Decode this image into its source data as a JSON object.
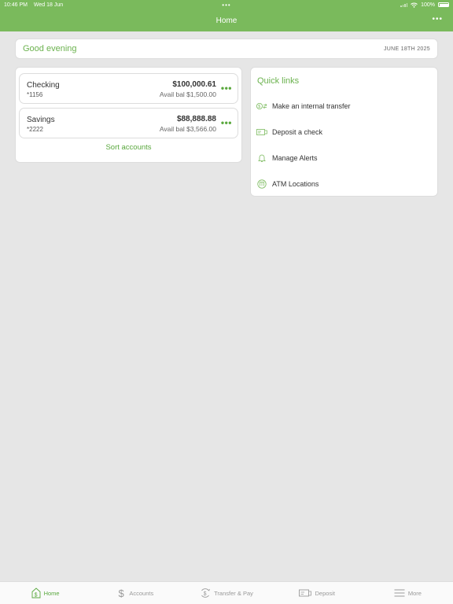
{
  "status_bar": {
    "time": "10:46 PM",
    "date": "Wed 18 Jun",
    "center_dots": "•••",
    "battery": "100%"
  },
  "header": {
    "title": "Home",
    "more": "•••"
  },
  "greeting": {
    "text": "Good evening",
    "date": "JUNE 18TH 2025"
  },
  "accounts": [
    {
      "name": "Checking",
      "number": "*1156",
      "balance": "$100,000.61",
      "available": "Avail bal $1,500.00"
    },
    {
      "name": "Savings",
      "number": "*2222",
      "balance": "$88,888.88",
      "available": "Avail bal $3,566.00"
    }
  ],
  "account_more": "•••",
  "sort_accounts": "Sort accounts",
  "quick_links": {
    "title": "Quick links",
    "items": [
      {
        "label": "Make an internal transfer",
        "icon": "transfer-icon"
      },
      {
        "label": "Deposit a check",
        "icon": "check-deposit-icon"
      },
      {
        "label": "Manage Alerts",
        "icon": "bell-icon"
      },
      {
        "label": "ATM Locations",
        "icon": "atm-icon"
      }
    ]
  },
  "tabs": [
    {
      "label": "Home",
      "icon": "home-dollar-icon",
      "active": true
    },
    {
      "label": "Accounts",
      "icon": "dollar-icon",
      "active": false
    },
    {
      "label": "Transfer & Pay",
      "icon": "transfer-pay-icon",
      "active": false
    },
    {
      "label": "Deposit",
      "icon": "deposit-check-icon",
      "active": false
    },
    {
      "label": "More",
      "icon": "menu-icon",
      "active": false
    }
  ],
  "colors": {
    "brand_green": "#7aba5c",
    "accent_green": "#5aa83e",
    "background": "#e6e6e6"
  }
}
